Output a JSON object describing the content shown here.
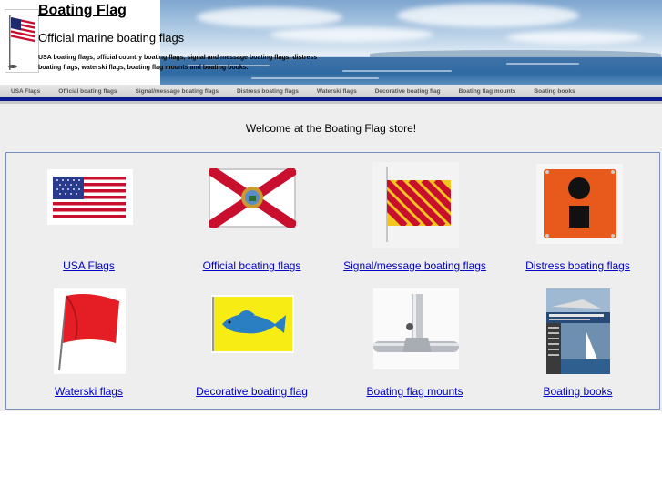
{
  "header": {
    "title": "Boating Flag",
    "subtitle": "Official marine boating flags",
    "description": "USA boating flags, official country boating flags, signal and message boating flags, distress boating flags, waterski flags, boating flag mounts and boating books."
  },
  "nav": {
    "items": [
      "USA Flags",
      "Official boating flags",
      "Signal/message boating flags",
      "Distress boating flags",
      "Waterski flags",
      "Decorative boating flag",
      "Boating flag mounts",
      "Boating books"
    ]
  },
  "main": {
    "welcome": "Welcome at the Boating Flag store!",
    "products": [
      {
        "label": "USA Flags",
        "icon": "usa-flag-image"
      },
      {
        "label": "Official boating flags",
        "icon": "florida-flag-image"
      },
      {
        "label": "Signal/message boating flags",
        "icon": "signal-flag-image"
      },
      {
        "label": "Distress boating flags",
        "icon": "distress-flag-image"
      },
      {
        "label": "Waterski flags",
        "icon": "waterski-flag-image"
      },
      {
        "label": "Decorative boating flag",
        "icon": "dolphin-flag-image"
      },
      {
        "label": "Boating flag mounts",
        "icon": "flag-mount-image"
      },
      {
        "label": "Boating books",
        "icon": "boating-book-image"
      }
    ]
  },
  "colors": {
    "nav_bar": "#0a1c8f",
    "link": "#0000cc",
    "grid_border": "#7a8fbe",
    "main_bg": "#eeeeee"
  }
}
